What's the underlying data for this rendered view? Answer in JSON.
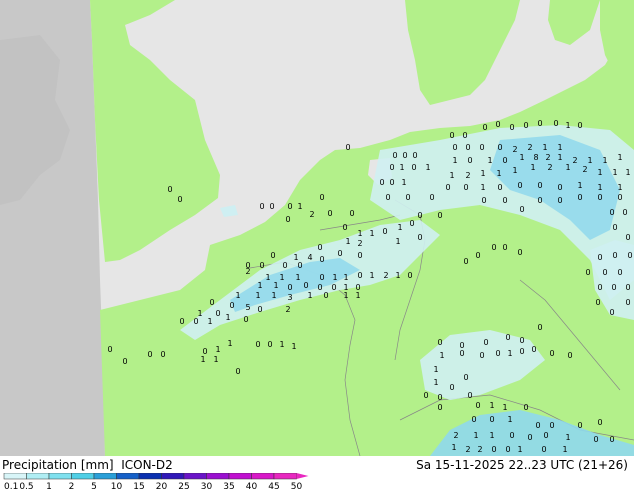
{
  "title": {
    "label": "Precipitation [mm]",
    "model": "ICON-D2"
  },
  "valid_time": "Sa 15-11-2025 22..23 UTC (21+26)",
  "colorbar": {
    "ticks": [
      "0.1",
      "0.5",
      "1",
      "2",
      "5",
      "10",
      "15",
      "20",
      "25",
      "30",
      "35",
      "40",
      "45",
      "50"
    ],
    "colors": [
      "#d8f5f8",
      "#b0eef4",
      "#7fe0ee",
      "#4fcfe6",
      "#2a9fd8",
      "#1560c8",
      "#0a30b0",
      "#3018b8",
      "#6a14c8",
      "#9a10d0",
      "#c010d0",
      "#d818c8",
      "#e828c0"
    ]
  },
  "colors": {
    "land": "#b3f08a",
    "sea": "#e6e6e6",
    "outside_domain": "#c8c8c8",
    "rain_light": "#cfeff2",
    "rain": "#8fd8ec"
  }
}
